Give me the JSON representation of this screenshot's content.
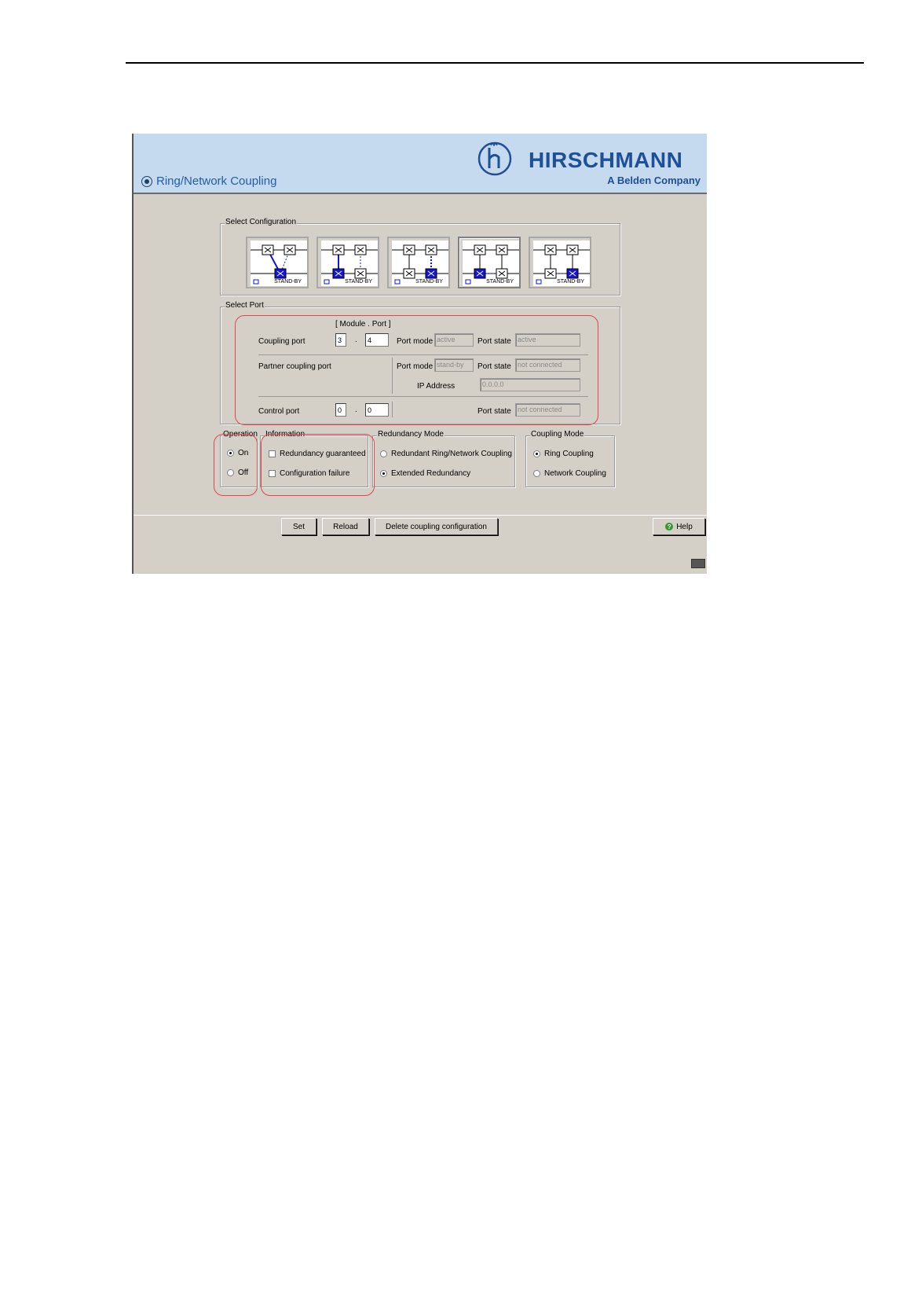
{
  "window": {
    "title": "Ring/Network Coupling",
    "brand": "HIRSCHMANN",
    "tagline": "A Belden Company"
  },
  "select_configuration": {
    "label": "Select Configuration",
    "options": [
      {
        "caption": "STAND-BY",
        "selected": false
      },
      {
        "caption": "STAND-BY",
        "selected": false
      },
      {
        "caption": "STAND-BY",
        "selected": false
      },
      {
        "caption": "STAND-BY",
        "selected": true
      },
      {
        "caption": "STAND-BY",
        "selected": false
      }
    ]
  },
  "select_port": {
    "label": "Select Port",
    "module_port_header": "[ Module . Port ]",
    "coupling_port": {
      "label": "Coupling port",
      "module": "3",
      "port": "4",
      "port_mode_label": "Port mode",
      "port_mode": "active",
      "port_state_label": "Port state",
      "port_state": "active"
    },
    "partner_coupling_port": {
      "label": "Partner coupling port",
      "port_mode_label": "Port mode",
      "port_mode": "stand-by",
      "port_state_label": "Port state",
      "port_state": "not connected",
      "ip_label": "IP Address",
      "ip": "0.0.0.0"
    },
    "control_port": {
      "label": "Control port",
      "module": "0",
      "port": "0",
      "port_state_label": "Port state",
      "port_state": "not connected"
    },
    "separator": "."
  },
  "operation": {
    "label": "Operation",
    "on": "On",
    "off": "Off",
    "value": "On"
  },
  "information": {
    "label": "Information",
    "redundancy_guaranteed": "Redundancy guaranteed",
    "configuration_failure": "Configuration failure"
  },
  "redundancy_mode": {
    "label": "Redundancy Mode",
    "opt1": "Redundant Ring/Network Coupling",
    "opt2": "Extended Redundancy",
    "value": "Extended Redundancy"
  },
  "coupling_mode": {
    "label": "Coupling Mode",
    "opt1": "Ring Coupling",
    "opt2": "Network Coupling",
    "value": "Ring Coupling"
  },
  "buttons": {
    "set": "Set",
    "reload": "Reload",
    "delete": "Delete coupling configuration",
    "help": "Help"
  },
  "colors": {
    "header_bg": "#c6daef",
    "panel_bg": "#d4d0c8",
    "brand_blue": "#1e4f97",
    "highlight_red": "#e0474c",
    "switch_blue": "#1515d6"
  }
}
